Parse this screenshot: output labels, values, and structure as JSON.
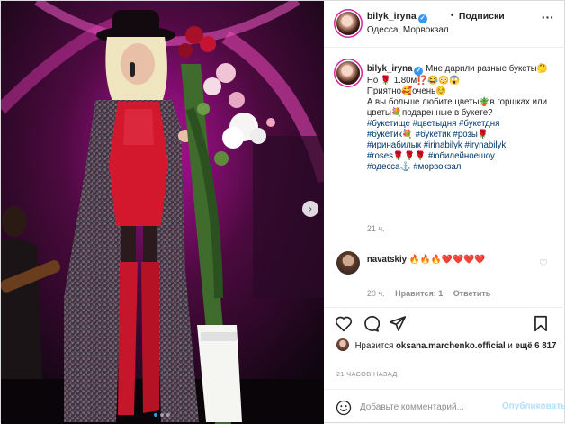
{
  "post": {
    "username": "bilyk_iryna",
    "separator": "•",
    "follow_label": "Подписки",
    "location": "Одесса, Морвокзал",
    "more_icon": "more-horizontal-icon"
  },
  "caption": {
    "username": "bilyk_iryna",
    "text_1": "Мне дарили разные букеты🤔",
    "text_2": "Но 🌹 1.80м⁉️😂😳😱",
    "text_3": "Приятно🥰очень☺️",
    "text_4": "А вы больше любите цветы🪴в горшках или цветы💐подаренные в букете?",
    "tags_1": "#букетище #цветыдня #букетдня",
    "tags_2": "#букетик💐 #букетик #розы🌹",
    "tags_3": "#иринабилык #irinabilyk #irynabilyk",
    "tags_4": "#roses🌹🌹🌹 #юбилейноешоу",
    "tags_5": "#одесса⚓ #морвокзал",
    "time": "21 ч."
  },
  "comment": {
    "username": "navatskiy",
    "text": "🔥🔥🔥❤️❤️❤️❤️",
    "time": "20 ч.",
    "likes": "Нравится: 1",
    "reply": "Ответить"
  },
  "likes": {
    "prefix": "Нравится",
    "user": "oksana.marchenko.official",
    "conj": "и",
    "others": "ещё 6 817"
  },
  "posted_time": "21 ЧАСОВ НАЗАД",
  "composer": {
    "placeholder": "Добавьте комментарий...",
    "publish": "Опубликовать"
  },
  "carousel": {
    "count": 3,
    "active": 1
  },
  "colors": {
    "accent": "#3897f0",
    "like_red": "#ed4956",
    "link": "#00376b",
    "publish_disabled": "#b2dffc"
  }
}
